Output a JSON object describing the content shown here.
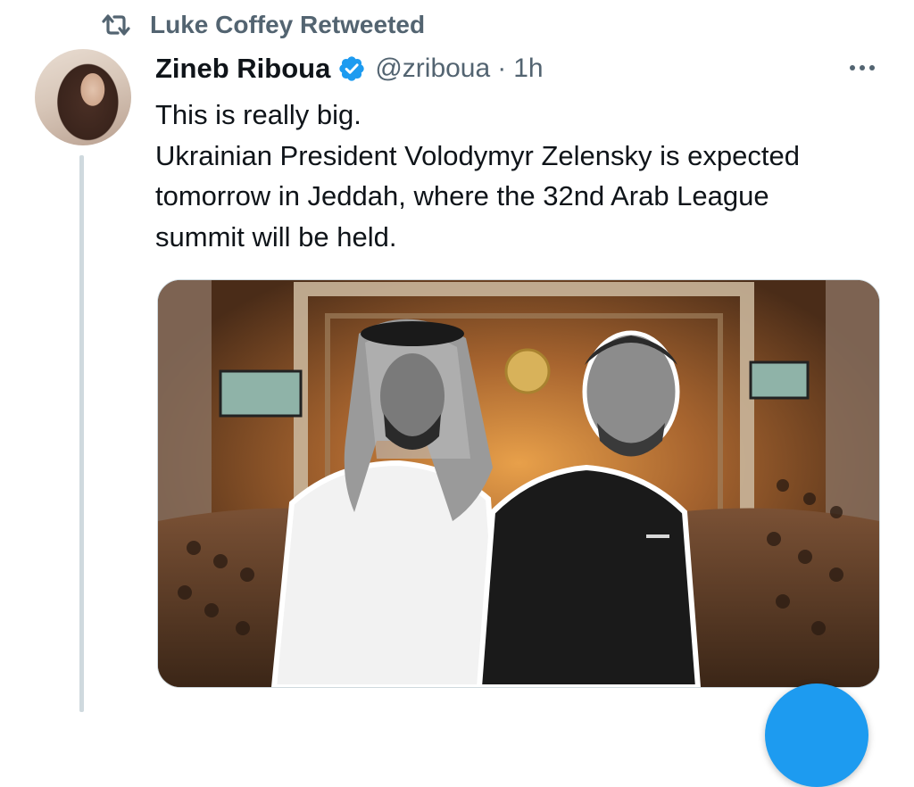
{
  "social_context": {
    "label": "Luke Coffey Retweeted",
    "icon": "retweet-icon"
  },
  "tweet": {
    "display_name": "Zineb Riboua",
    "handle": "@zriboua",
    "separator": "·",
    "timestamp": "1h",
    "verified": true,
    "text_lines": [
      "This is really big.",
      "Ukrainian President Volodymyr Zelensky is expected",
      "tomorrow in Jeddah, where the 32nd Arab League",
      "summit will be held."
    ],
    "media_alt": ""
  },
  "colors": {
    "accent": "#1d9bf0",
    "secondary_text": "#536471",
    "thread_line": "#cfd9de"
  }
}
